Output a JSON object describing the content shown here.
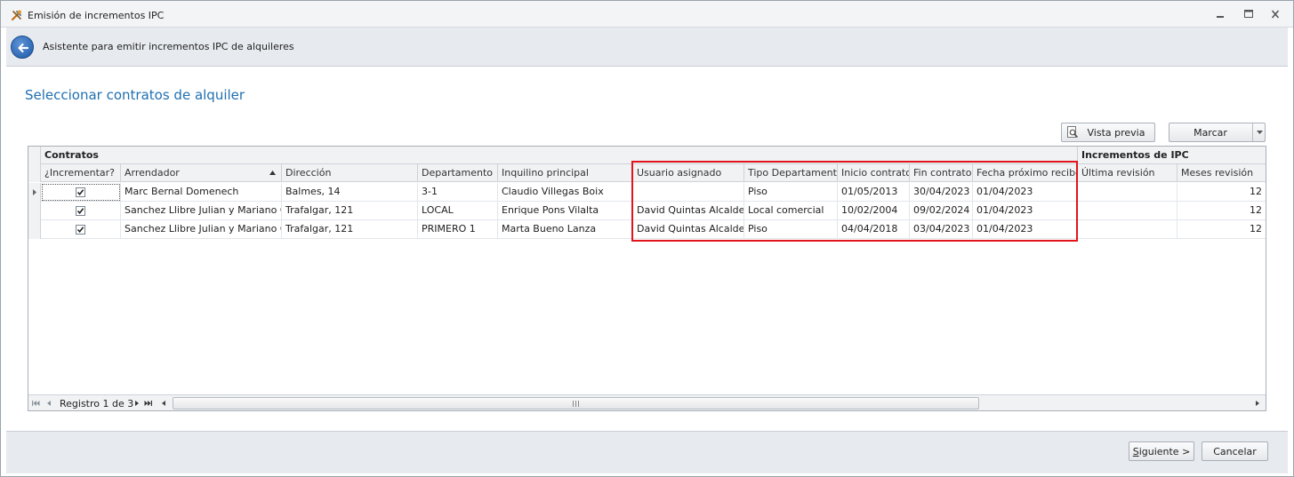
{
  "window": {
    "title": "Emisión de incrementos IPC",
    "icon": "tools-icon",
    "controls": [
      "minimize-icon",
      "maximize-icon",
      "close-icon"
    ]
  },
  "wizard": {
    "header_text": "Asistente para emitir incrementos IPC de alquileres",
    "back_icon": "back-arrow-icon"
  },
  "page": {
    "title": "Seleccionar contratos de alquiler"
  },
  "toolbar": {
    "preview_label": "Vista previa",
    "mark_label": "Marcar"
  },
  "grid": {
    "bands": {
      "contratos": "Contratos",
      "incrementos": "Incrementos de IPC"
    },
    "columns": {
      "incrementar": "¿Incrementar?",
      "arrendador": "Arrendador",
      "direccion": "Dirección",
      "departamento": "Departamento",
      "inquilino": "Inquilino principal",
      "usuario": "Usuario asignado",
      "tipo": "Tipo Departamento",
      "inicio": "Inicio contrato",
      "fin": "Fin contrato",
      "proximo": "Fecha próximo recibo",
      "ultima": "Última revisión",
      "meses": "Meses revisión"
    },
    "sort": {
      "column": "Arrendador",
      "direction": "ascending"
    },
    "rows": [
      {
        "incrementar": true,
        "arrendador": "Marc Bernal Domenech",
        "direccion": "Balmes, 14",
        "departamento": "3-1",
        "inquilino": "Claudio Villegas Boix",
        "usuario": "",
        "tipo": "Piso",
        "inicio": "01/05/2013",
        "fin": "30/04/2023",
        "proximo": "01/04/2023",
        "ultima": "",
        "meses": "12"
      },
      {
        "incrementar": true,
        "arrendador": "Sanchez Llibre Julian y Mariano C.B.",
        "direccion": "Trafalgar, 121",
        "departamento": "LOCAL",
        "inquilino": "Enrique Pons Vilalta",
        "usuario": "David Quintas Alcalde",
        "tipo": "Local comercial",
        "inicio": "10/02/2004",
        "fin": "09/02/2024",
        "proximo": "01/04/2023",
        "ultima": "",
        "meses": "12"
      },
      {
        "incrementar": true,
        "arrendador": "Sanchez Llibre Julian y Mariano C.B.",
        "direccion": "Trafalgar, 121",
        "departamento": "PRIMERO 1",
        "inquilino": "Marta Bueno Lanza",
        "usuario": "David Quintas Alcalde",
        "tipo": "Piso",
        "inicio": "04/04/2018",
        "fin": "03/04/2023",
        "proximo": "01/04/2023",
        "ultima": "",
        "meses": "12"
      }
    ],
    "navigator": {
      "record_text": "Registro 1 de 3"
    },
    "highlight_color": "#e0141a"
  },
  "footer": {
    "next_label": "Siguiente >",
    "cancel_label": "Cancelar"
  },
  "colors": {
    "accent_title": "#1f6fb0",
    "back_button": "#1d5aa8"
  }
}
